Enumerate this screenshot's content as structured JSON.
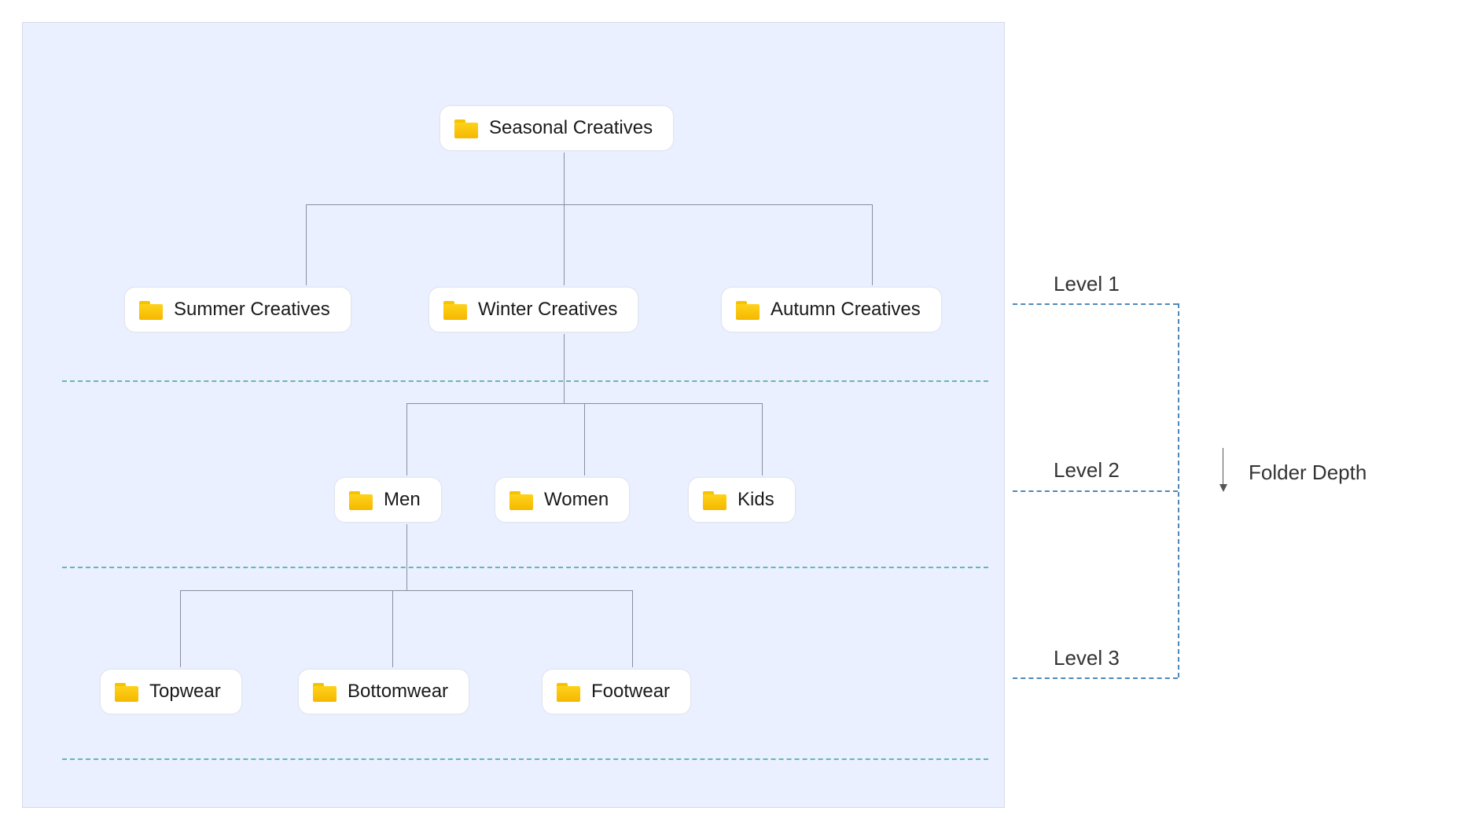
{
  "tree": {
    "root": {
      "label": "Seasonal Creatives"
    },
    "level1": [
      {
        "label": "Summer Creatives"
      },
      {
        "label": "Winter Creatives"
      },
      {
        "label": "Autumn Creatives"
      }
    ],
    "level2": [
      {
        "label": "Men"
      },
      {
        "label": "Women"
      },
      {
        "label": "Kids"
      }
    ],
    "level3": [
      {
        "label": "Topwear"
      },
      {
        "label": "Bottomwear"
      },
      {
        "label": "Footwear"
      }
    ]
  },
  "legend": {
    "levels": [
      "Level 1",
      "Level 2",
      "Level 3"
    ],
    "depth_label": "Folder Depth"
  }
}
